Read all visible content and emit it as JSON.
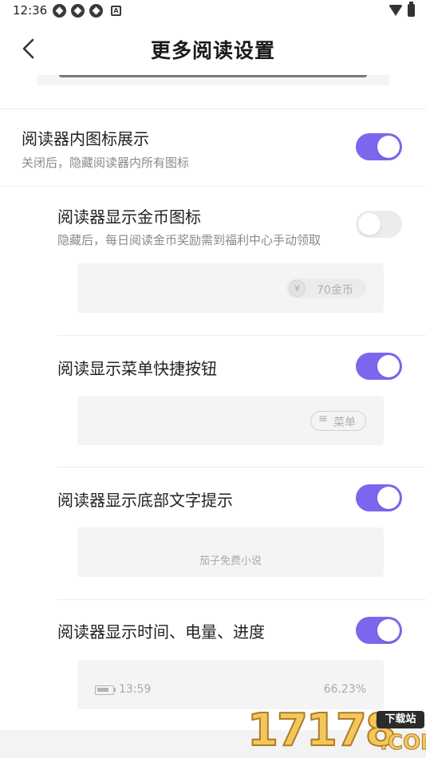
{
  "status_bar": {
    "time": "12:36",
    "notification_icons": [
      "app-icon",
      "app-icon",
      "app-icon",
      "a-icon"
    ],
    "system_icons": [
      "wifi-icon",
      "battery-icon"
    ]
  },
  "header": {
    "title": "更多阅读设置",
    "back_icon": "chevron-left-icon"
  },
  "colors": {
    "accent": "#7b67ee",
    "toggle_off": "#ececec",
    "preview_bg": "#f4f4f4"
  },
  "settings": [
    {
      "title": "阅读器内图标展示",
      "subtitle": "关闭后，隐藏阅读器内所有图标",
      "enabled": true
    },
    {
      "title": "阅读器显示金币图标",
      "subtitle": "隐藏后，每日阅读金币奖励需到福利中心手动领取",
      "enabled": false,
      "preview": {
        "coin_symbol": "¥",
        "coin_label": "70金币"
      }
    },
    {
      "title": "阅读显示菜单快捷按钮",
      "enabled": true,
      "preview": {
        "menu_icon": "≡",
        "menu_label": "菜单"
      }
    },
    {
      "title": "阅读器显示底部文字提示",
      "enabled": true,
      "preview": {
        "footer_text": "茄子免费小说"
      }
    },
    {
      "title": "阅读器显示时间、电量、进度",
      "enabled": true,
      "preview": {
        "time": "13:59",
        "progress": "66.23%",
        "battery_level": 0.8
      }
    }
  ],
  "watermark": {
    "digits": "17178",
    "tag": "下载站",
    "suffix": ".COM"
  }
}
